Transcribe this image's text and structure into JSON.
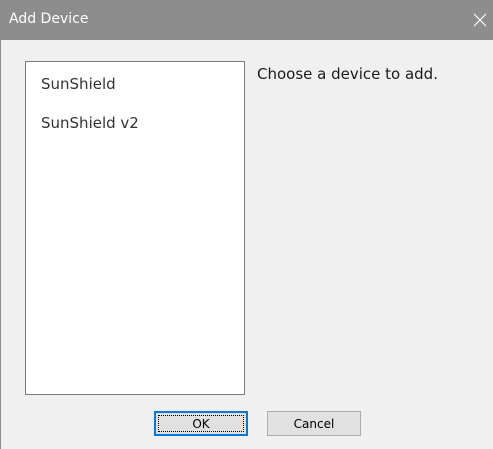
{
  "window": {
    "title": "Add Device",
    "close_glyph": "✕"
  },
  "device_list": {
    "items": [
      "SunShield",
      "SunShield v2"
    ]
  },
  "instruction": "Choose a device to add.",
  "buttons": {
    "ok_label": "OK",
    "cancel_label": "Cancel"
  },
  "colors": {
    "titlebar": "#8d8d8d",
    "dialog_background": "#f0f0f0",
    "focus_border": "#0078d7"
  },
  "icons": {
    "close": "close-icon"
  }
}
